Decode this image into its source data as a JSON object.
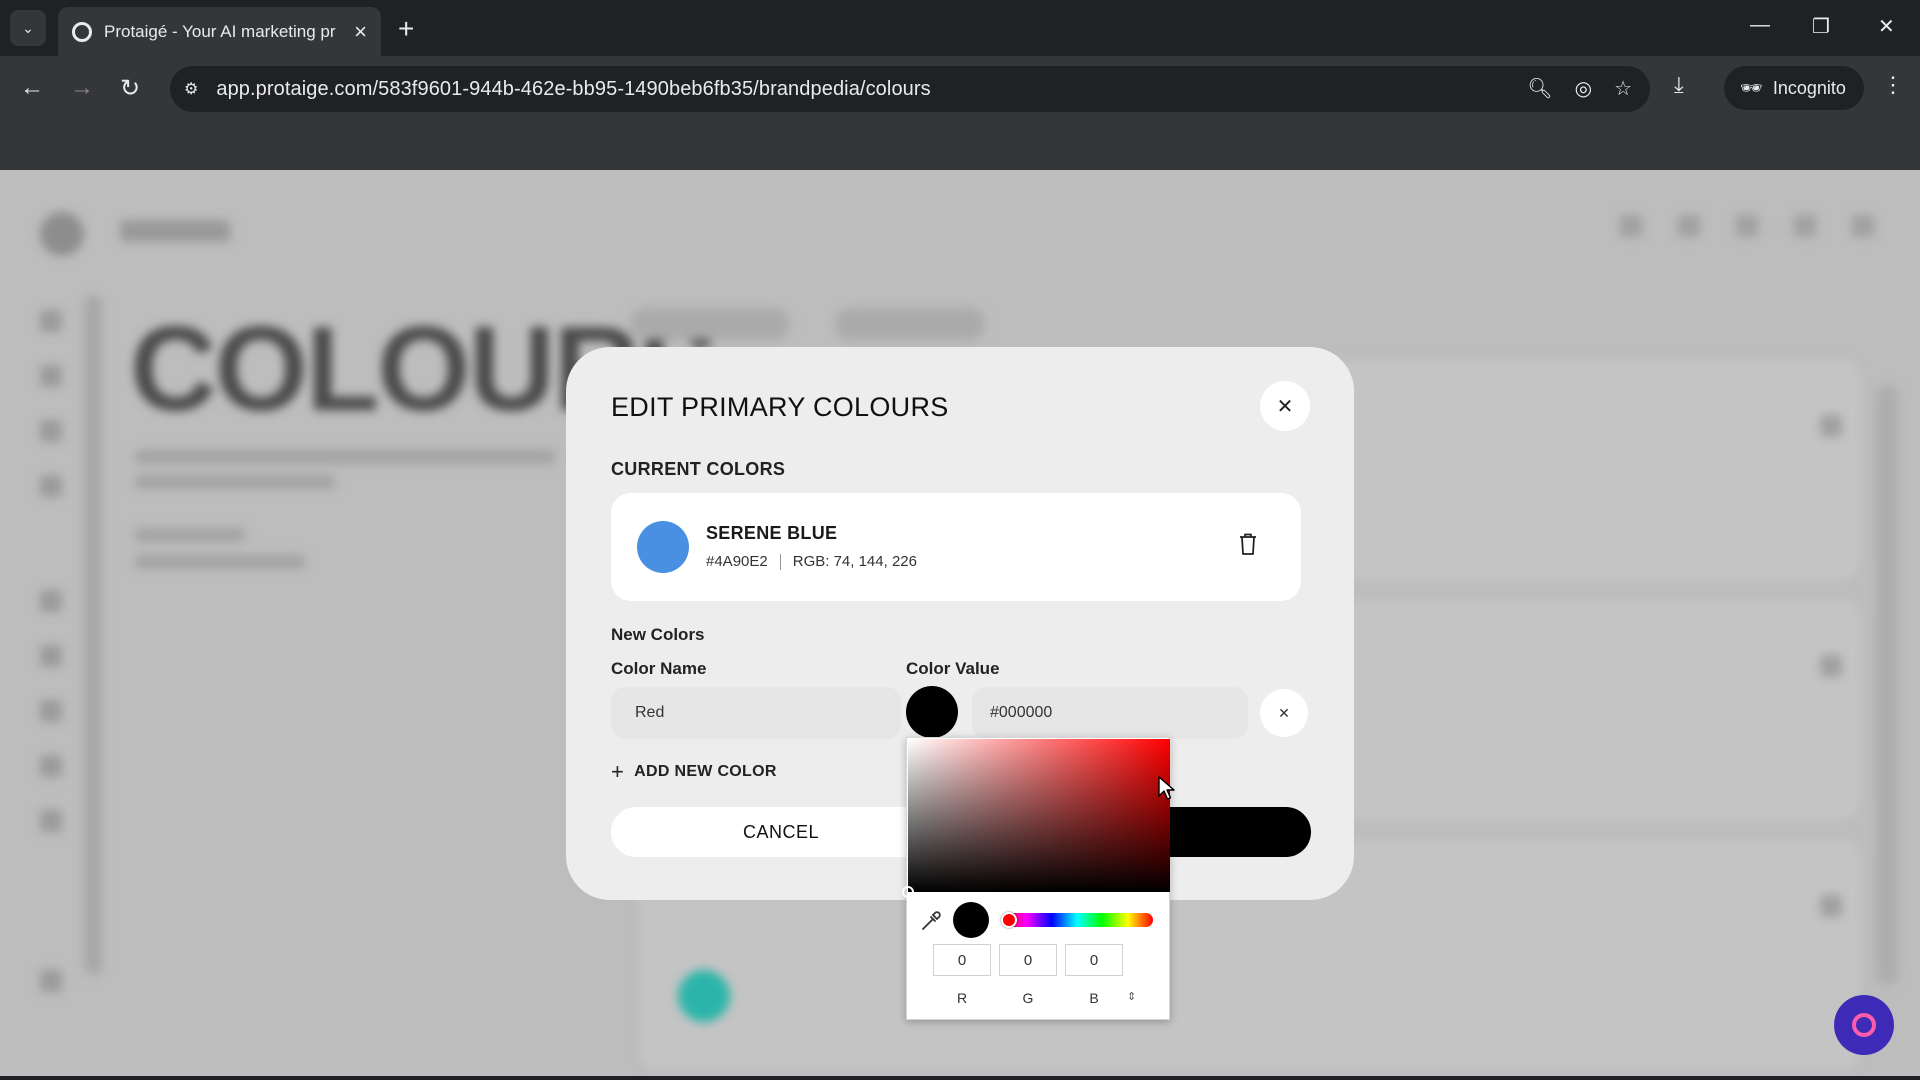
{
  "browser": {
    "tab_title": "Protaigé - Your AI marketing pr",
    "url": "app.protaige.com/583f9601-944b-462e-bb95-1490beb6fb35/brandpedia/colours",
    "incognito_label": "Incognito"
  },
  "background": {
    "heading": "COLOURS"
  },
  "modal": {
    "title": "EDIT PRIMARY COLOURS",
    "current_label": "CURRENT COLORS",
    "current_colors": [
      {
        "name": "SERENE BLUE",
        "hex": "#4A90E2",
        "rgb": "RGB: 74, 144, 226",
        "swatch_color": "#4A90E2"
      }
    ],
    "new_colors_label": "New Colors",
    "color_name_label": "Color Name",
    "color_value_label": "Color Value",
    "new_color": {
      "name": "Red",
      "value": "#000000"
    },
    "add_new_label": "ADD NEW COLOR",
    "cancel_label": "CANCEL"
  },
  "picker": {
    "r": "0",
    "g": "0",
    "b": "0",
    "r_label": "R",
    "g_label": "G",
    "b_label": "B"
  },
  "colors": {
    "accent_dark": "#000000",
    "chat_fab": "#3d2bb8"
  }
}
